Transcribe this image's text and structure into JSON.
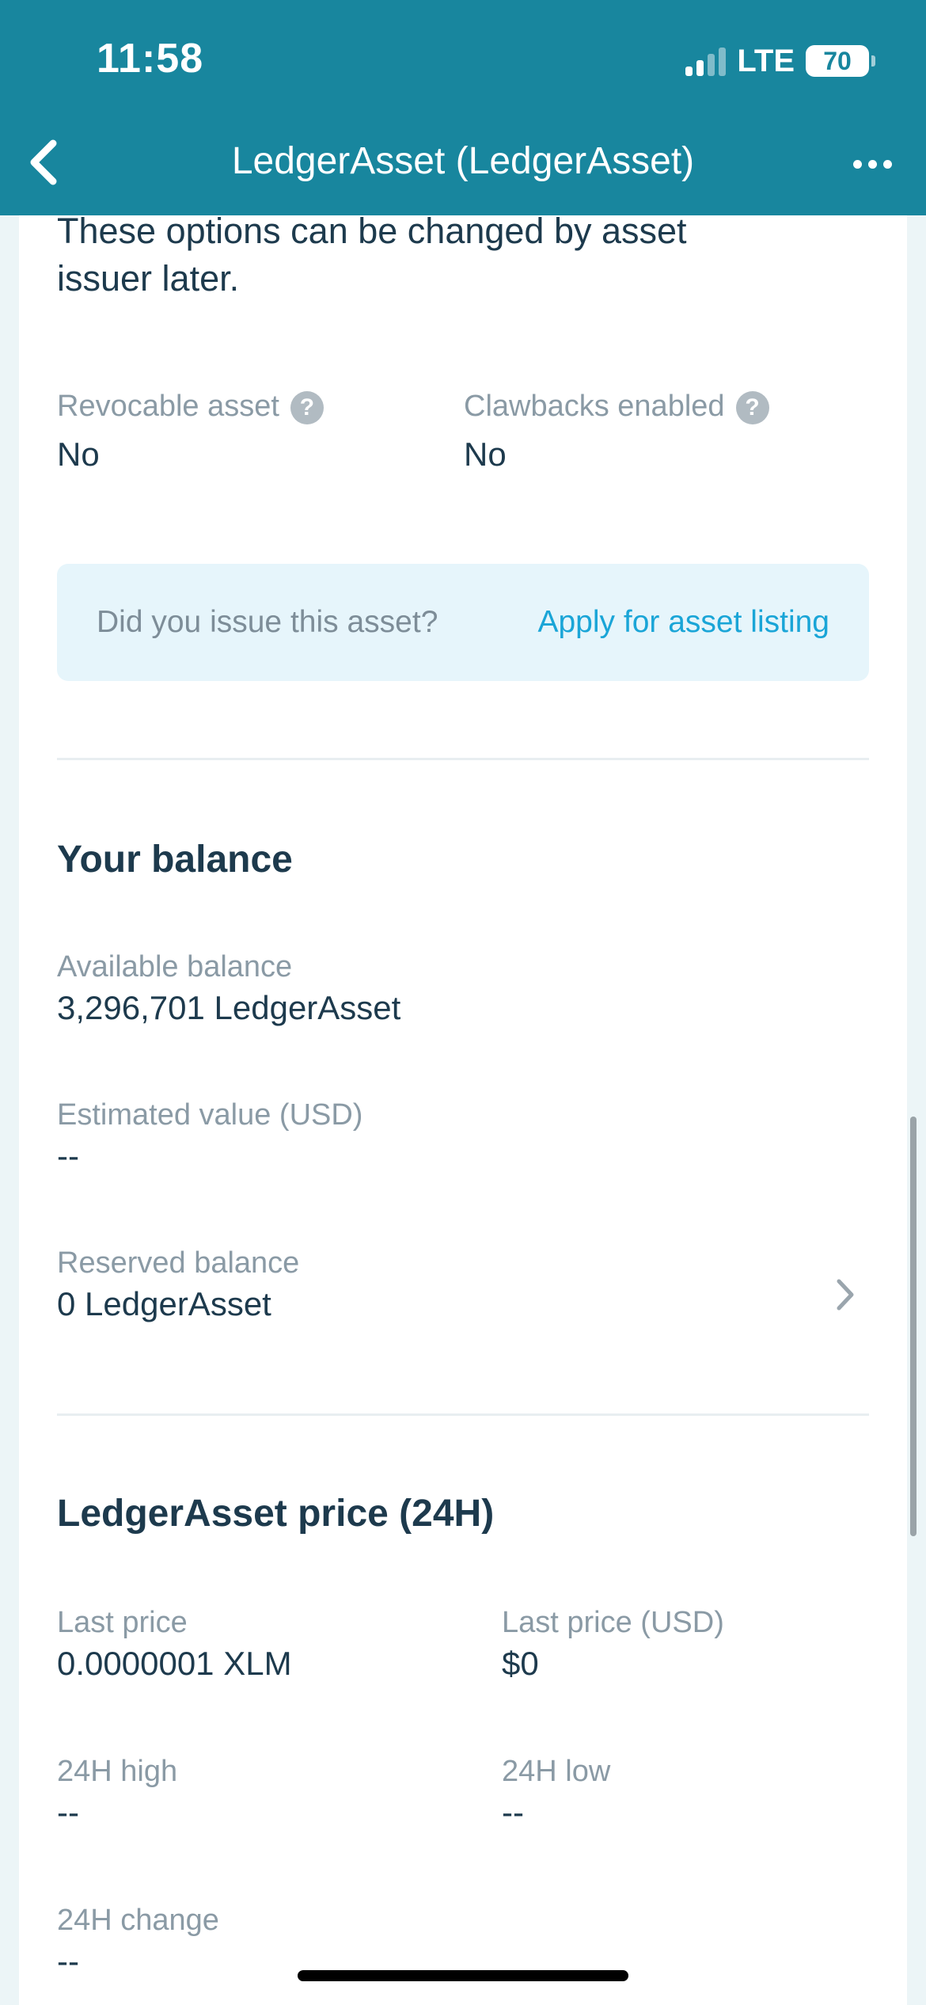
{
  "status_bar": {
    "time": "11:58",
    "network": "LTE",
    "battery": "70",
    "signal_level": 0.5
  },
  "nav": {
    "title": "LedgerAsset (LedgerAsset)",
    "back_icon": "chevron-left-icon",
    "more_icon": "more-horizontal-icon"
  },
  "options_note": "These options can be changed by asset issuer later.",
  "flags": {
    "revocable": {
      "label": "Revocable asset",
      "value": "No",
      "help": "?"
    },
    "clawbacks": {
      "label": "Clawbacks enabled",
      "value": "No",
      "help": "?"
    }
  },
  "listing_banner": {
    "question": "Did you issue this asset?",
    "link": "Apply for asset listing"
  },
  "balance": {
    "title": "Your balance",
    "available": {
      "label": "Available balance",
      "value": "3,296,701 LedgerAsset"
    },
    "estimated": {
      "label": "Estimated value (USD)",
      "value": "--"
    },
    "reserved": {
      "label": "Reserved balance",
      "value": "0 LedgerAsset"
    }
  },
  "price": {
    "title": "LedgerAsset price (24H)",
    "last_price": {
      "label": "Last price",
      "value": "0.0000001 XLM"
    },
    "last_price_usd": {
      "label": "Last price (USD)",
      "value": "$0"
    },
    "high": {
      "label": "24H high",
      "value": "--"
    },
    "low": {
      "label": "24H low",
      "value": "--"
    },
    "change": {
      "label": "24H change",
      "value": "--"
    }
  },
  "colors": {
    "header": "#18869e",
    "link": "#1aa5d7",
    "banner_bg": "#e6f5fb",
    "text_primary": "#1d3a4d",
    "text_label": "#8a9aa5"
  }
}
